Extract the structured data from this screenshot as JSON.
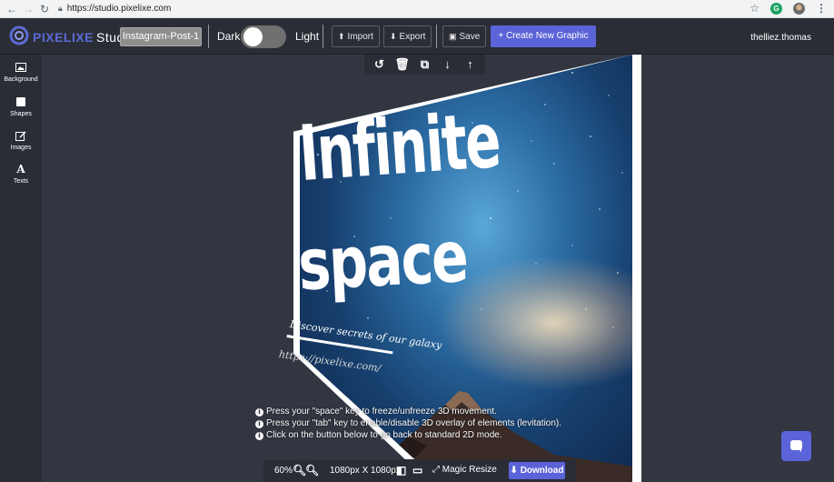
{
  "browser": {
    "url": "https://studio.pixelixe.com"
  },
  "app": {
    "logo_brand": "PIXELIXE",
    "logo_product": "Studio",
    "document_name": "Instagram-Post-1",
    "theme": {
      "dark_label": "Dark",
      "light_label": "Light"
    },
    "actions": {
      "import": "Import",
      "export": "Export",
      "save": "Save",
      "create": "+ Create New Graphic"
    },
    "user": "thelliez.thomas",
    "accent_color": "#5b63d8"
  },
  "sidebar": {
    "items": [
      {
        "label": "Background",
        "icon": "image-icon"
      },
      {
        "label": "Shapes",
        "icon": "square-icon"
      },
      {
        "label": "Images",
        "icon": "edit-icon"
      },
      {
        "label": "Texts",
        "icon": "text-icon"
      }
    ]
  },
  "element_toolbar": {
    "icons": [
      "rotate-icon",
      "trash-icon",
      "duplicate-icon",
      "arrow-down-icon",
      "arrow-up-icon"
    ]
  },
  "poster": {
    "title_line1": "Infinite",
    "title_line2": "space",
    "subtitle": "Discover secrets of our galaxy",
    "url": "https://pixelixe.com/"
  },
  "instructions": [
    "Press your \"space\" key to freeze/unfreeze 3D movement.",
    "Press your \"tab\" key to enable/disable 3D overlay of elements (levitation).",
    "Click on the  button below to go back to standard 2D mode."
  ],
  "bottom_bar": {
    "zoom": "60%",
    "size": "1080px X 1080px",
    "magic_resize": "Magic Resize",
    "download": "Download"
  }
}
